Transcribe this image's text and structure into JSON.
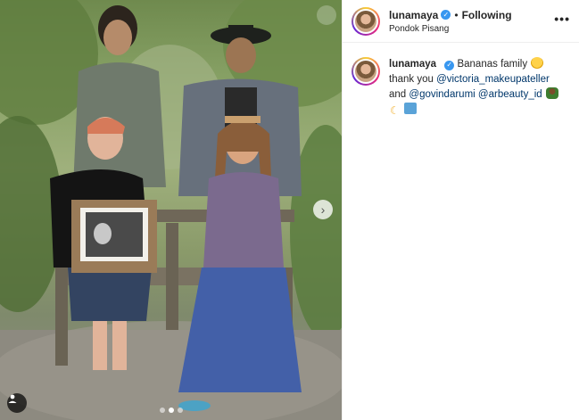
{
  "post": {
    "username": "lunamaya",
    "follow_status": "Following",
    "location": "Pondok Pisang",
    "more_icon_text": "•••",
    "caption": {
      "username": "lunamaya",
      "line1_text": "Bananas family",
      "line2_text": "thank you",
      "mention1": "@victoria_makeupateller",
      "line3_text": "and",
      "mention2": "@govindarumi",
      "mention3": "@arbeauty_id"
    }
  },
  "icons": {
    "verified": "verified-badge-icon",
    "more": "more-options-icon",
    "next": "chevron-right-icon",
    "tag": "user-tag-icon"
  },
  "colors": {
    "verified": "#3897f0",
    "mention": "#00376b",
    "text": "#262626",
    "border": "#efefef"
  },
  "carousel": {
    "count": 3,
    "active": 1
  }
}
